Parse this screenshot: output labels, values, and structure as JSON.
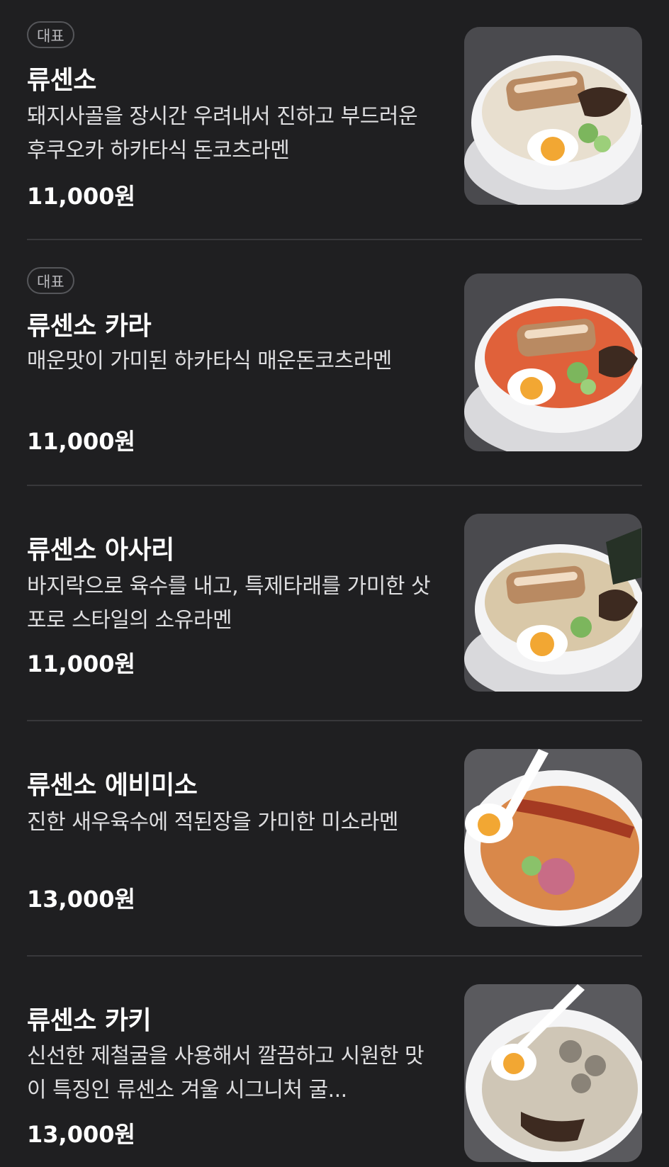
{
  "menu": {
    "items": [
      {
        "badge": "대표",
        "name": "류센소",
        "description": "돼지사골을 장시간 우려내서 진하고 부드러운 후쿠오카 하카타식 돈코츠라멘",
        "price": "11,000원",
        "image": "tonkotsu-ramen-photo"
      },
      {
        "badge": "대표",
        "name": "류센소 카라",
        "description": "매운맛이 가미된 하카타식 매운돈코츠라멘",
        "price": "11,000원",
        "image": "spicy-tonkotsu-ramen-photo"
      },
      {
        "badge": "",
        "name": "류센소 아사리",
        "description": "바지락으로 육수를 내고, 특제타래를 가미한 삿포로 스타일의 소유라멘",
        "price": "11,000원",
        "image": "clam-shoyu-ramen-photo"
      },
      {
        "badge": "",
        "name": "류센소 에비미소",
        "description": "진한 새우육수에 적된장을 가미한 미소라멘",
        "price": "13,000원",
        "image": "shrimp-miso-ramen-photo"
      },
      {
        "badge": "",
        "name": "류센소 카키",
        "description": "신선한 제철굴을 사용해서 깔끔하고 시원한 맛이 특징인 류센소 겨울 시그니처 굴...",
        "price": "13,000원",
        "image": "oyster-ramen-photo"
      }
    ]
  }
}
